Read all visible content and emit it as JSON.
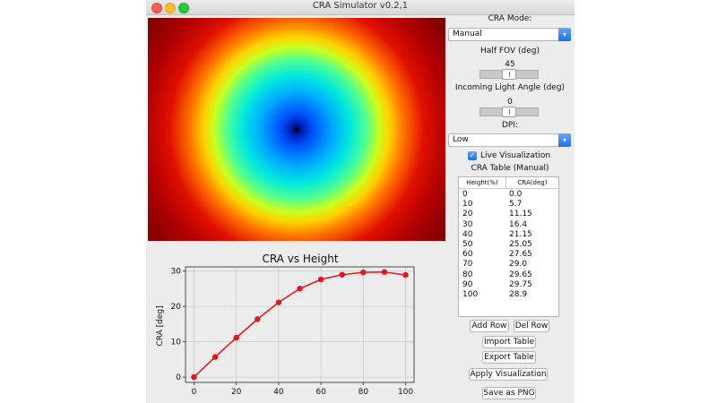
{
  "window": {
    "title": "CRA Simulator v0.2,1"
  },
  "controls": {
    "mode_label": "CRA Mode:",
    "mode_value": "Manual",
    "half_fov_label": "Half FOV (deg)",
    "half_fov_value": "45",
    "half_fov_level": 0.5,
    "light_angle_label": "Incoming Light Angle (deg)",
    "light_angle_value": "0",
    "light_angle_level": 0.5,
    "dpi_label": "DPI:",
    "dpi_value": "Low",
    "live_viz_label": "Live Visualization",
    "live_viz_checked": true
  },
  "table": {
    "title": "CRA Table (Manual)",
    "columns": [
      "Height(%)",
      "CRA(deg)"
    ],
    "rows": [
      [
        "0",
        "0.0"
      ],
      [
        "10",
        "5.7"
      ],
      [
        "20",
        "11.15"
      ],
      [
        "30",
        "16.4"
      ],
      [
        "40",
        "21.15"
      ],
      [
        "50",
        "25.05"
      ],
      [
        "60",
        "27.65"
      ],
      [
        "70",
        "29.0"
      ],
      [
        "80",
        "29.65"
      ],
      [
        "90",
        "29.75"
      ],
      [
        "100",
        "28.9"
      ]
    ]
  },
  "buttons": {
    "add_row": "Add Row",
    "del_row": "Del Row",
    "import_table": "Import Table",
    "export_table": "Export Table",
    "apply_visualization": "Apply Visualization",
    "save_png": "Save as PNG"
  },
  "chart_data": {
    "type": "line",
    "title": "CRA vs Height",
    "xlabel": "",
    "ylabel": "CRA [deg]",
    "x": [
      0,
      10,
      20,
      30,
      40,
      50,
      60,
      70,
      80,
      90,
      100
    ],
    "series": [
      {
        "values": [
          0.0,
          5.7,
          11.15,
          16.4,
          21.15,
          25.05,
          27.65,
          29.0,
          29.65,
          29.75,
          28.9
        ],
        "color": "#e8141c"
      }
    ],
    "xlim": [
      -4,
      104
    ],
    "ylim": [
      -1.5,
      31.2
    ],
    "xticks": [
      0,
      20,
      40,
      60,
      80,
      100
    ],
    "yticks": [
      0,
      10,
      20,
      30
    ],
    "grid": true
  }
}
